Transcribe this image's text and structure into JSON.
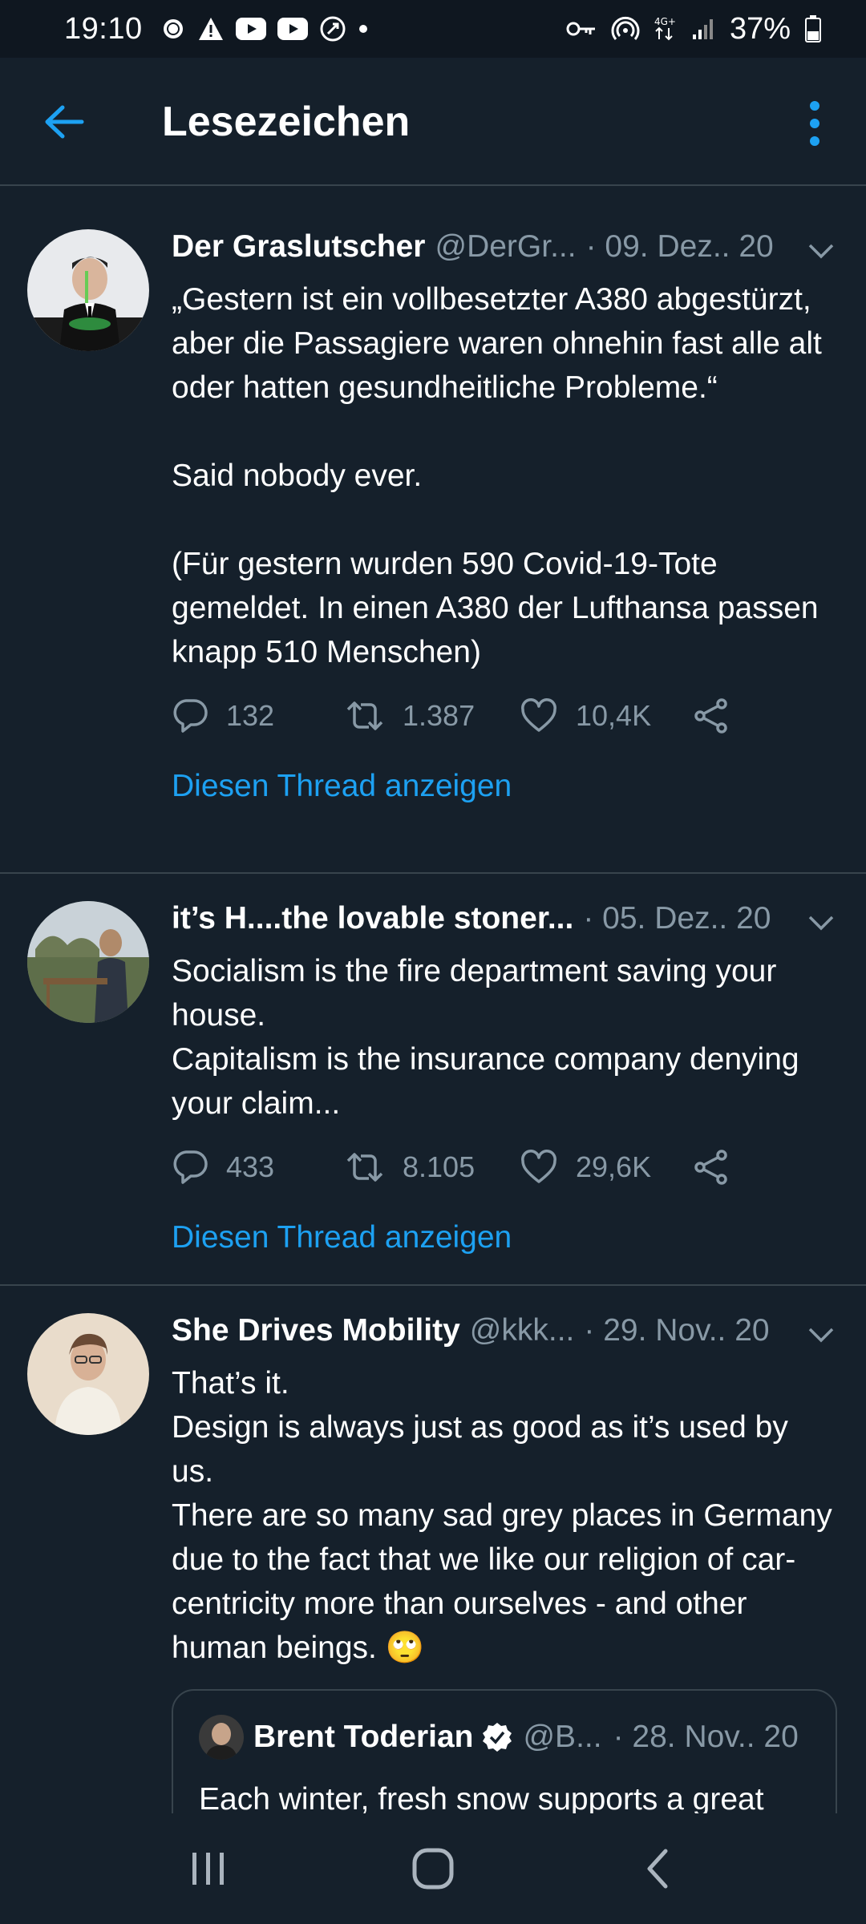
{
  "status_bar": {
    "time": "19:10",
    "battery": "37%",
    "network": "4G+"
  },
  "header": {
    "title": "Lesezeichen",
    "back_icon": "arrow-left-icon",
    "menu_icon": "more-vertical-icon"
  },
  "colors": {
    "accent": "#1da1f2",
    "background": "#15202b",
    "secondary_text": "#8899a6",
    "divider": "#38444d"
  },
  "tweets": [
    {
      "name": "Der Graslutscher",
      "handle": "@DerGr...",
      "date": "· 09. Dez.. 20",
      "text": "„Gestern ist ein vollbesetzter A380 abgestürzt, aber die Passagiere waren ohnehin fast alle alt oder hatten gesundheitliche Probleme.“\n\nSaid nobody ever.\n\n(Für gestern wurden 590 Covid-19-Tote gemeldet. In einen A380 der Lufthansa passen knapp 510 Menschen)",
      "replies": "132",
      "retweets": "1.387",
      "likes": "10,4K",
      "thread_link": "Diesen Thread anzeigen"
    },
    {
      "name": "it’s H....the lovable stoner...",
      "handle": "",
      "date": "· 05. Dez.. 20",
      "text": "Socialism is the fire department saving your house.\nCapitalism is the insurance company denying your claim...",
      "replies": "433",
      "retweets": "8.105",
      "likes": "29,6K",
      "thread_link": "Diesen Thread anzeigen"
    },
    {
      "name": "She Drives Mobility",
      "handle": "@kkk...",
      "date": "· 29. Nov.. 20",
      "text": "That’s it.\nDesign is always just as good as it’s used by us.\nThere are so many sad grey places in Germany due to the fact that we like our religion of car-centricity more than ourselves - and other human beings. 🙄",
      "quote": {
        "name": "Brent Toderian",
        "handle": "@B...",
        "date": "· 28. Nov.. 20",
        "text": "Each winter, fresh snow supports a great"
      }
    }
  ],
  "nav": {
    "recents_icon": "recent-apps-icon",
    "home_icon": "home-icon",
    "back_icon": "back-icon"
  }
}
